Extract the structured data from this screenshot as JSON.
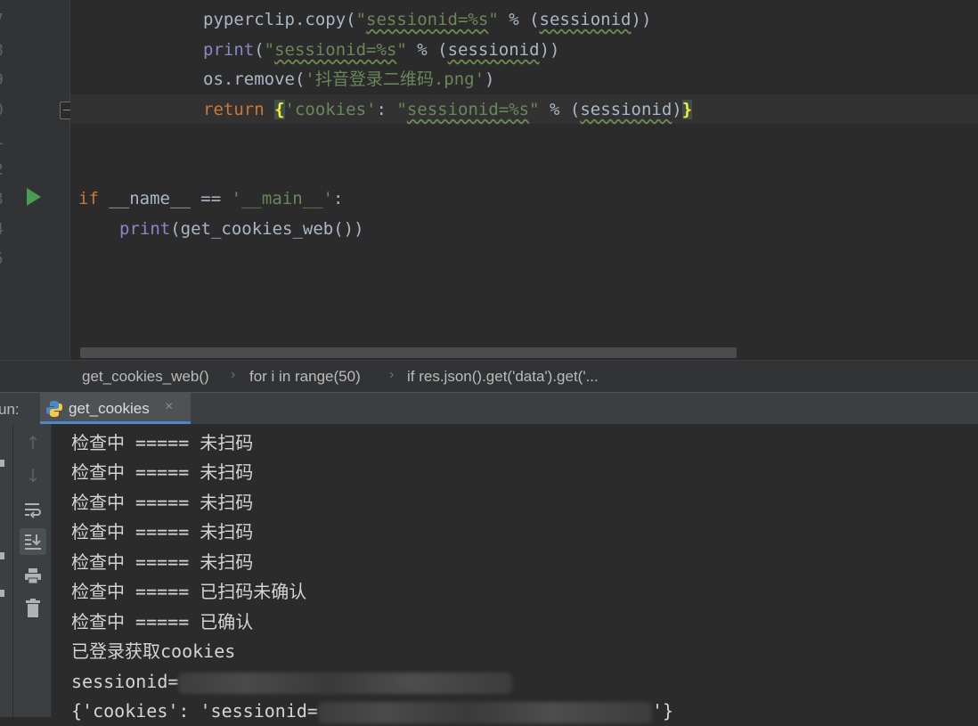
{
  "editor": {
    "line_numbers": [
      "7",
      "8",
      "9",
      "0",
      "1",
      "2",
      "3",
      "4",
      "5"
    ],
    "lines": {
      "l7": {
        "fn": "pyperclip.copy(",
        "str_a": "\"",
        "str_b": "sessionid=%s",
        "str_c": "\"",
        "rest_a": " % (",
        "arg": "sessionid",
        "rest_b": "))"
      },
      "l8": {
        "fn": "print",
        "p1": "(",
        "str_a": "\"",
        "str_b": "sessionid=%s",
        "str_c": "\"",
        "rest_a": " % (",
        "arg": "sessionid",
        "rest_b": "))"
      },
      "l9": {
        "fn": "os.remove(",
        "str": "'抖音登录二维码.png'",
        "rest": ")"
      },
      "l10": {
        "kw": "return ",
        "brace_open": "{",
        "key": "'cookies'",
        "colon": ": ",
        "str_a": "\"",
        "str_b": "sessionid=%s",
        "str_c": "\"",
        "rest_a": " % (",
        "arg": "sessionid",
        "rest_b": ")",
        "brace_close": "}"
      },
      "l13": {
        "kw": "if",
        "mid": " __name__ == ",
        "str": "'__main__'",
        "end": ":"
      },
      "l14": {
        "fn": "print",
        "rest": "(get_cookies_web())"
      }
    }
  },
  "breadcrumb": {
    "items": [
      "get_cookies_web()",
      "for i in range(50)",
      "if res.json().get('data').get('..."
    ]
  },
  "run": {
    "label": "un:",
    "tab_label": "get_cookies",
    "tab_close": "×",
    "icons": [
      "arrow-up",
      "arrow-down",
      "soft-wrap",
      "scroll-to-end",
      "print",
      "trash"
    ]
  },
  "console": {
    "lines": [
      "检查中 ===== 未扫码",
      "检查中 ===== 未扫码",
      "检查中 ===== 未扫码",
      "检查中 ===== 未扫码",
      "检查中 ===== 未扫码",
      "检查中 ===== 已扫码未确认",
      "检查中 ===== 已确认",
      "已登录获取cookies"
    ],
    "session_line_prefix": "sessionid=",
    "dict_line_prefix": "{'cookies': 'sessionid=",
    "dict_line_suffix": "'}"
  },
  "colors": {
    "background": "#2b2b2b",
    "keyword": "#cc7832",
    "string": "#6a8759",
    "builtin": "#8888c6",
    "text": "#a9b7c6",
    "run_icon": "#499c54",
    "tab_underline": "#4a88c7"
  }
}
